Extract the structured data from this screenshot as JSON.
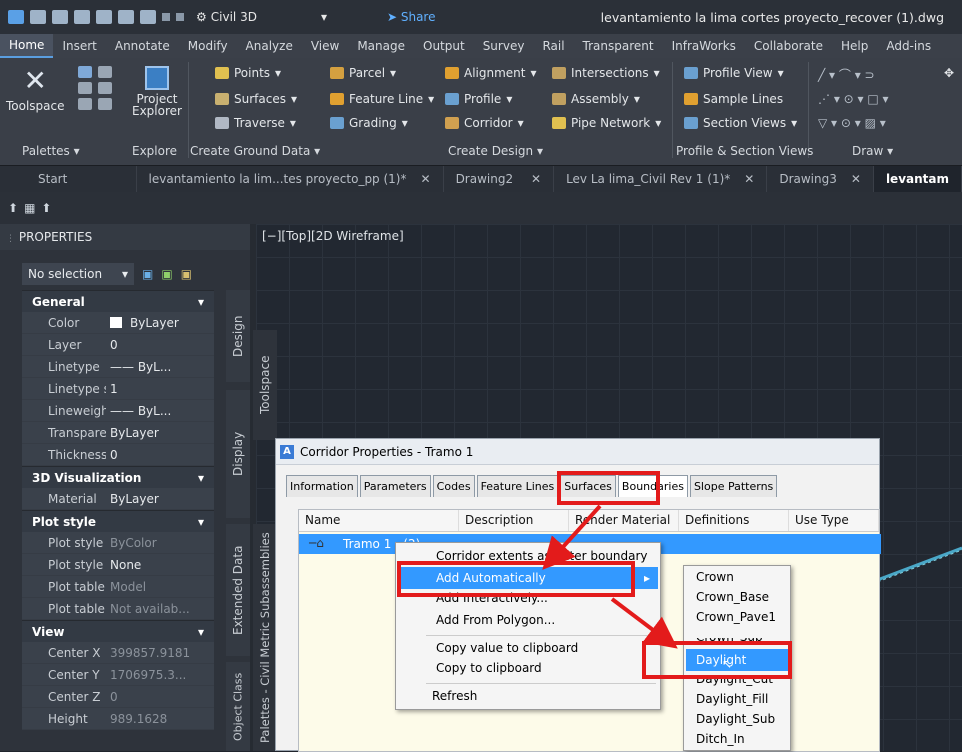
{
  "titlebar": {
    "workspace": "Civil 3D",
    "share": "Share",
    "document_title": "levantamiento la lima cortes proyecto_recover (1).dwg"
  },
  "menubar": [
    "Home",
    "Insert",
    "Annotate",
    "Modify",
    "Analyze",
    "View",
    "Manage",
    "Output",
    "Survey",
    "Rail",
    "Transparent",
    "InfraWorks",
    "Collaborate",
    "Help",
    "Add-ins"
  ],
  "ribbon": {
    "toolspace": "Toolspace",
    "project_explorer_1": "Project",
    "project_explorer_2": "Explorer",
    "points": "Points",
    "surfaces": "Surfaces",
    "traverse": "Traverse",
    "parcel": "Parcel",
    "feature_line": "Feature Line",
    "grading": "Grading",
    "alignment": "Alignment",
    "profile": "Profile",
    "corridor": "Corridor",
    "intersections": "Intersections",
    "assembly": "Assembly",
    "pipe_network": "Pipe Network",
    "profile_view": "Profile View",
    "sample_lines": "Sample Lines",
    "section_views": "Section Views",
    "panels": {
      "palettes": "Palettes",
      "explore": "Explore",
      "create_ground_data": "Create Ground Data",
      "create_design": "Create Design",
      "profile_section_views": "Profile & Section Views",
      "draw": "Draw"
    }
  },
  "doc_tabs": [
    {
      "label": "Start"
    },
    {
      "label": "levantamiento la lim...tes proyecto_pp (1)*"
    },
    {
      "label": "Drawing2"
    },
    {
      "label": "Lev La lima_Civil Rev 1 (1)*"
    },
    {
      "label": "Drawing3"
    },
    {
      "label": "levantam"
    }
  ],
  "viewport_label": "[−][Top][2D Wireframe]",
  "properties": {
    "header": "PROPERTIES",
    "selection": "No selection",
    "sections": {
      "general": "General",
      "visualization": "3D Visualization",
      "plot_style": "Plot style",
      "view": "View"
    },
    "general_rows": [
      {
        "k": "Color",
        "v": "ByLayer"
      },
      {
        "k": "Layer",
        "v": "0"
      },
      {
        "k": "Linetype",
        "v": "—— ByL..."
      },
      {
        "k": "Linetype sc...",
        "v": "1"
      },
      {
        "k": "Lineweight",
        "v": "—— ByL..."
      },
      {
        "k": "Transparency",
        "v": "ByLayer"
      },
      {
        "k": "Thickness",
        "v": "0"
      }
    ],
    "visualization_rows": [
      {
        "k": "Material",
        "v": "ByLayer"
      }
    ],
    "plot_rows": [
      {
        "k": "Plot style",
        "v": "ByColor"
      },
      {
        "k": "Plot style ta...",
        "v": "None"
      },
      {
        "k": "Plot table a...",
        "v": "Model"
      },
      {
        "k": "Plot table ty...",
        "v": "Not availab..."
      }
    ],
    "view_rows": [
      {
        "k": "Center X",
        "v": "399857.9181"
      },
      {
        "k": "Center Y",
        "v": "1706975.3..."
      },
      {
        "k": "Center Z",
        "v": "0"
      },
      {
        "k": "Height",
        "v": "989.1628"
      }
    ]
  },
  "side_tabs": {
    "design": "Design",
    "display": "Display",
    "extended": "Extended Data",
    "toolspace": "Toolspace",
    "civil_metric": "Palettes - Civil Metric Subassemblies",
    "object_class": "Object Class"
  },
  "dialog": {
    "title": "Corridor Properties - Tramo 1",
    "tabs": [
      "Information",
      "Parameters",
      "Codes",
      "Feature Lines",
      "Surfaces",
      "Boundaries",
      "Slope Patterns"
    ],
    "columns": [
      "Name",
      "Description",
      "Render Material",
      "Definitions",
      "Use Type"
    ],
    "row_name": "Tramo 1 - (2)"
  },
  "context_menu": {
    "items": [
      "Corridor extents as outer boundary",
      "Add Automatically",
      "Add Interactively...",
      "Add From Polygon...",
      "Copy value to clipboard",
      "Copy to clipboard",
      "Refresh"
    ]
  },
  "submenu": {
    "items": [
      "Crown",
      "Crown_Base",
      "Crown_Pave1",
      "Crown_Sub",
      "Daylight",
      "Daylight_Cut",
      "Daylight_Fill",
      "Daylight_Sub",
      "Ditch_In"
    ]
  },
  "colors": {
    "highlight": "#3399ff",
    "annotation_red": "#e31b1b",
    "ui_dark": "#2b3038"
  }
}
